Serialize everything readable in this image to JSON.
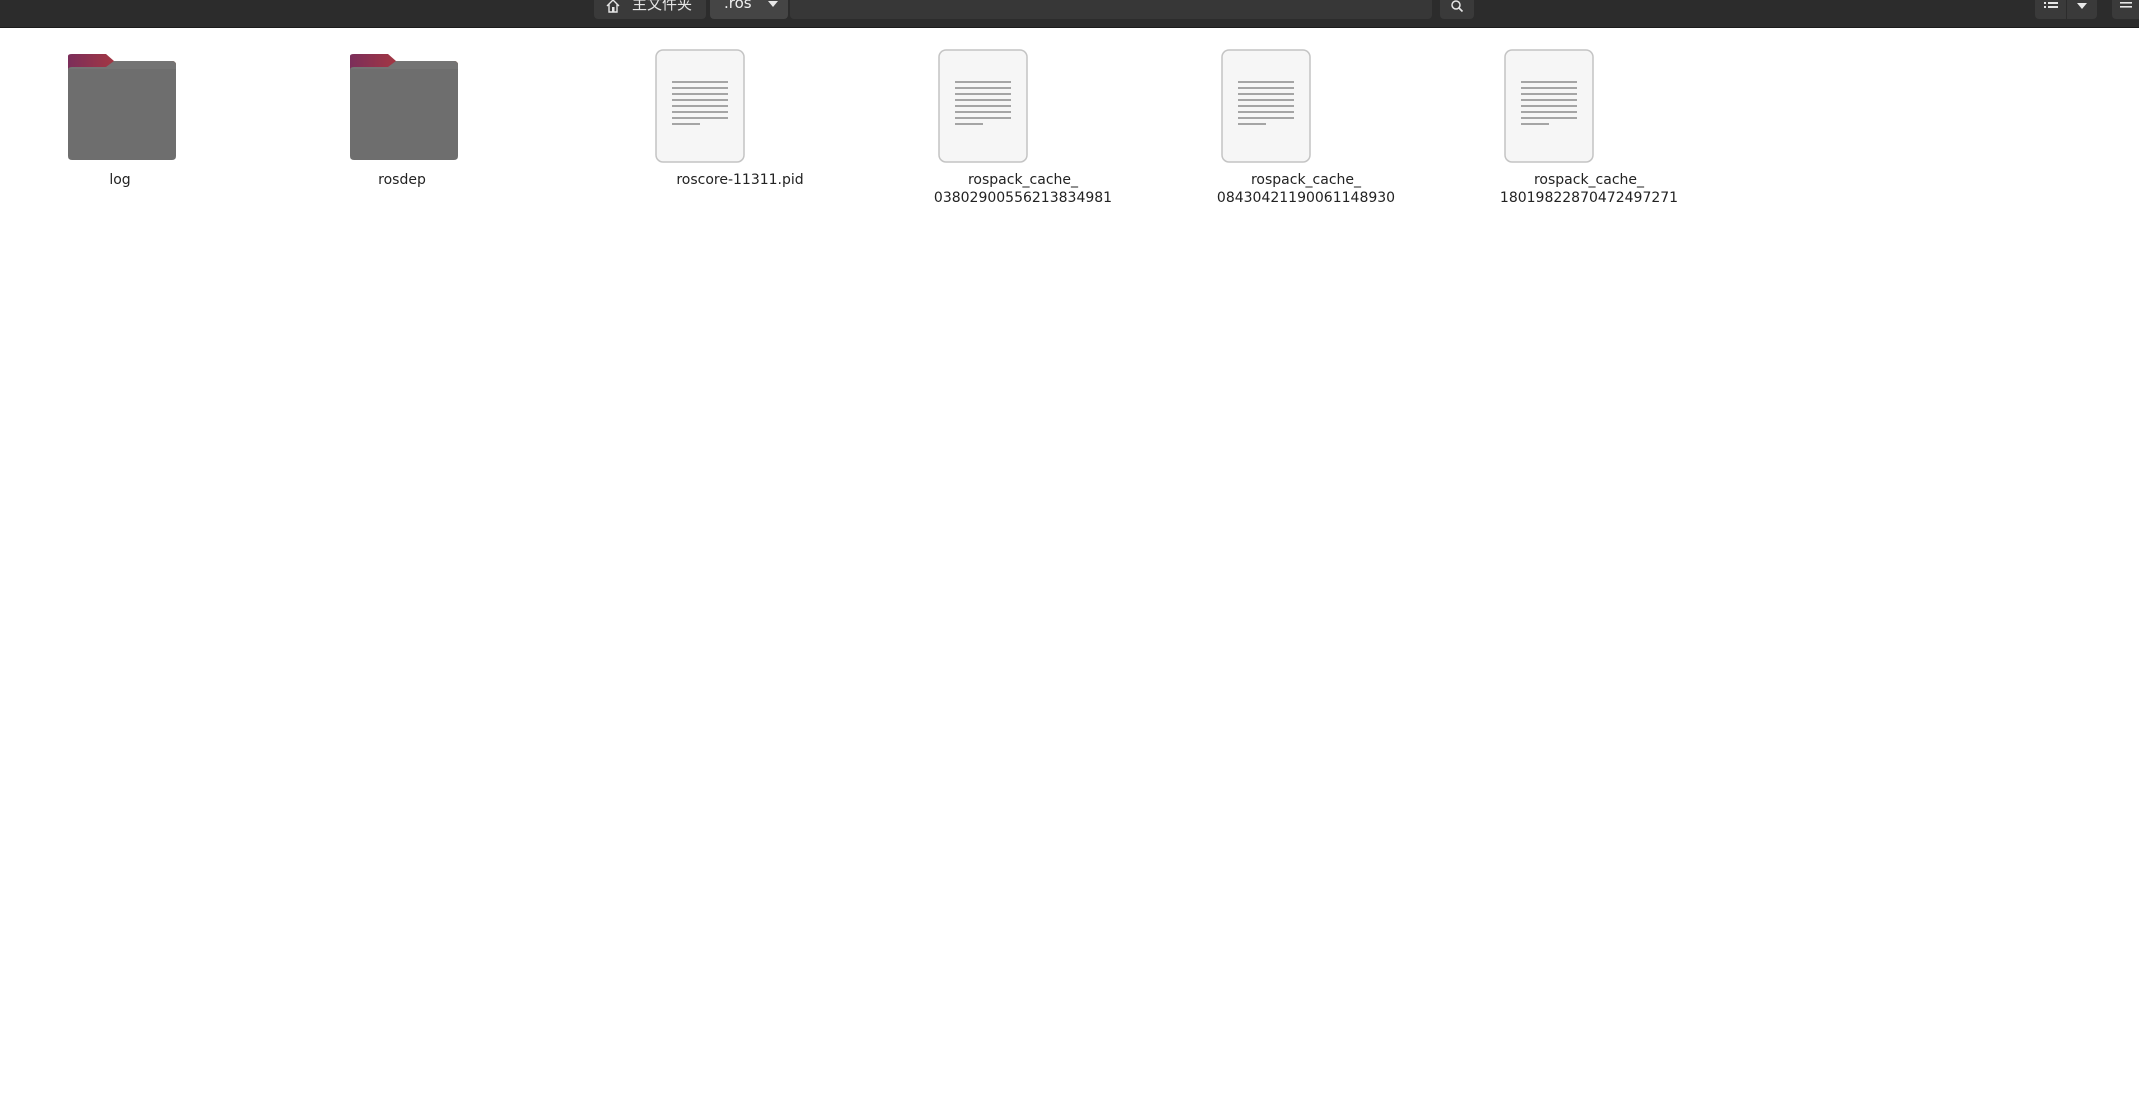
{
  "toolbar": {
    "home_label": "主文件夹",
    "home_icon": "home-icon",
    "current_folder": ".ros",
    "search_icon": "search-icon",
    "view_icon": "list-view-icon",
    "menu_icon": "hamburger-menu-icon"
  },
  "colors": {
    "toolbar_bg": "#2c2c2c",
    "folder_body": "#6e6e6e",
    "folder_tab_start": "#7b2e5a",
    "folder_tab_end": "#e9561f",
    "window_bg": "#ffffff"
  },
  "files": [
    {
      "type": "folder",
      "icon": "folder-icon",
      "name_line1": "log",
      "name_line2": ""
    },
    {
      "type": "folder",
      "icon": "folder-icon",
      "name_line1": "rosdep",
      "name_line2": ""
    },
    {
      "type": "file",
      "icon": "text-document-icon",
      "name_line1": "roscore-11311.pid",
      "name_line2": ""
    },
    {
      "type": "file",
      "icon": "text-document-icon",
      "name_line1": "rospack_cache_",
      "name_line2": "03802900556213834981"
    },
    {
      "type": "file",
      "icon": "text-document-icon",
      "name_line1": "rospack_cache_",
      "name_line2": "08430421190061148930"
    },
    {
      "type": "file",
      "icon": "text-document-icon",
      "name_line1": "rospack_cache_",
      "name_line2": "18019822870472497271"
    }
  ]
}
